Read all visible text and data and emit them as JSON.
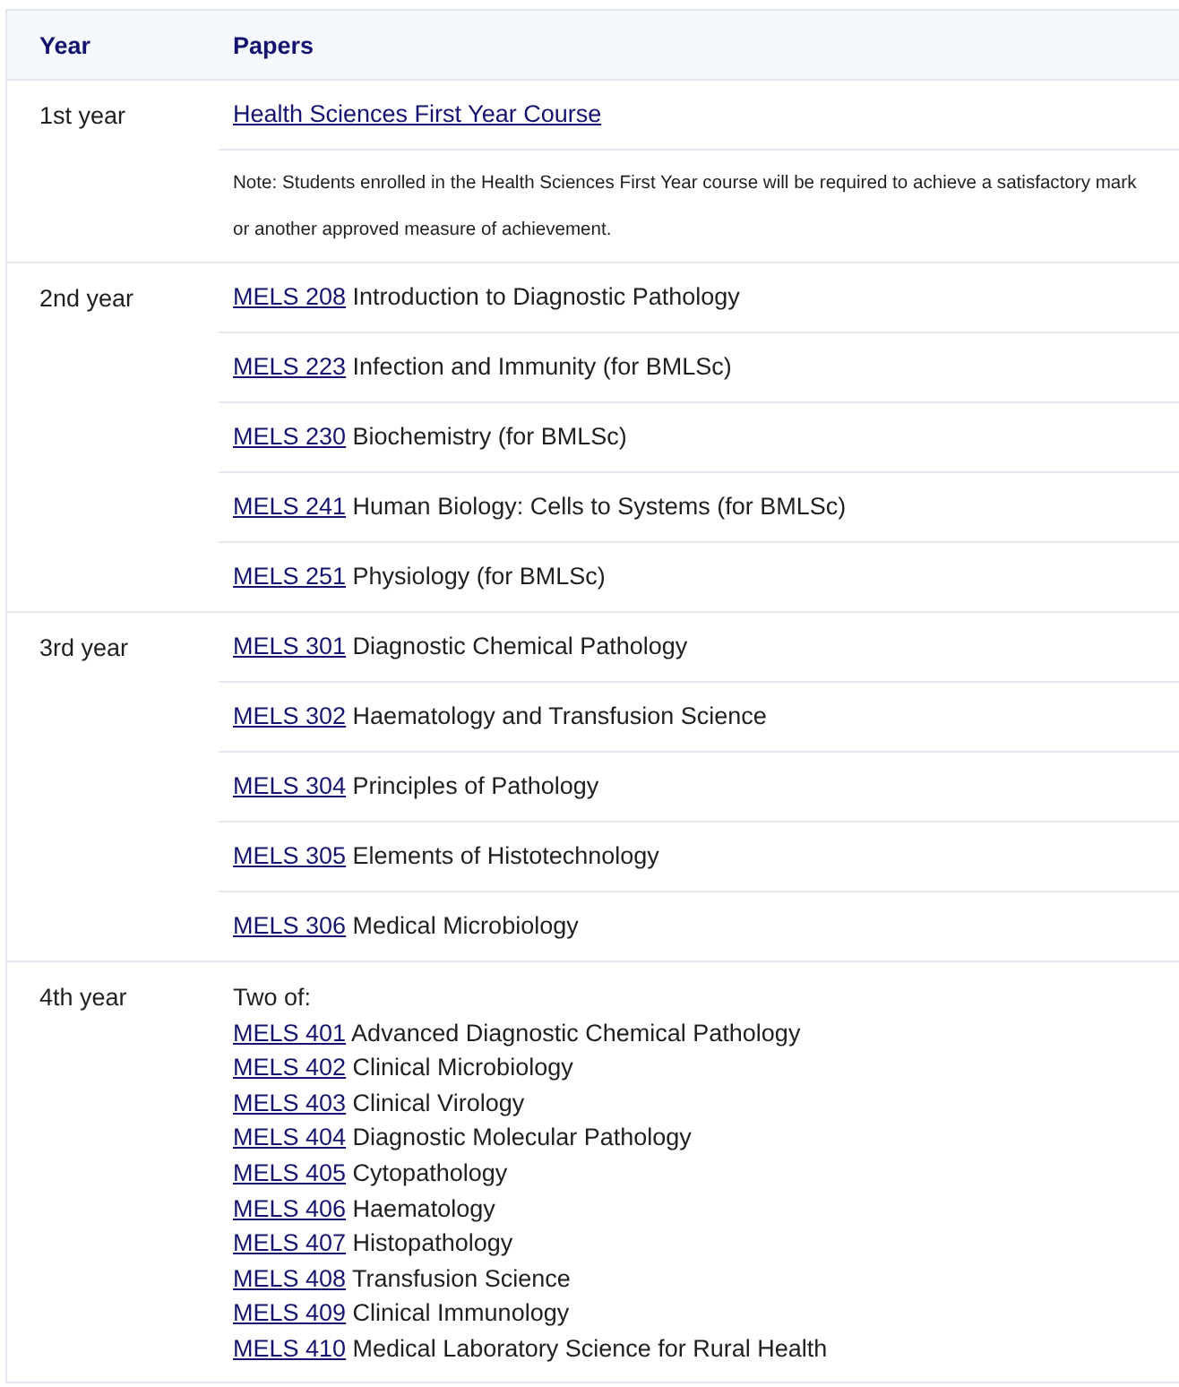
{
  "table": {
    "columns": [
      "Year",
      "Papers"
    ],
    "rows": [
      {
        "year": "1st year",
        "papers": [
          {
            "kind": "link",
            "text": "Health Sciences First Year Course"
          },
          {
            "kind": "note",
            "lines": [
              "Note: Students enrolled in the Health Sciences First Year course will be required to achieve a satisfactory mark",
              "or another approved measure of achievement."
            ]
          }
        ]
      },
      {
        "year": "2nd year",
        "papers": [
          {
            "kind": "paper",
            "code": "MELS 208",
            "title": "Introduction to Diagnostic Pathology"
          },
          {
            "kind": "paper",
            "code": "MELS 223",
            "title": "Infection and Immunity (for BMLSc)"
          },
          {
            "kind": "paper",
            "code": "MELS 230",
            "title": "Biochemistry (for BMLSc)"
          },
          {
            "kind": "paper",
            "code": "MELS 241",
            "title": "Human Biology: Cells to Systems (for BMLSc)"
          },
          {
            "kind": "paper",
            "code": "MELS 251",
            "title": "Physiology (for BMLSc)"
          }
        ]
      },
      {
        "year": "3rd year",
        "papers": [
          {
            "kind": "paper",
            "code": "MELS 301",
            "title": "Diagnostic Chemical Pathology"
          },
          {
            "kind": "paper",
            "code": "MELS 302",
            "title": "Haematology and Transfusion Science"
          },
          {
            "kind": "paper",
            "code": "MELS 304",
            "title": "Principles of Pathology"
          },
          {
            "kind": "paper",
            "code": "MELS 305",
            "title": "Elements of Histotechnology"
          },
          {
            "kind": "paper",
            "code": "MELS 306",
            "title": "Medical Microbiology"
          }
        ]
      },
      {
        "year": "4th year",
        "papers": [
          {
            "kind": "choice",
            "intro": "Two of:",
            "options": [
              {
                "code": "MELS 401",
                "title": "Advanced Diagnostic Chemical Pathology"
              },
              {
                "code": "MELS 402",
                "title": "Clinical Microbiology"
              },
              {
                "code": "MELS 403",
                "title": "Clinical Virology"
              },
              {
                "code": "MELS 404",
                "title": "Diagnostic Molecular Pathology"
              },
              {
                "code": "MELS 405",
                "title": "Cytopathology"
              },
              {
                "code": "MELS 406",
                "title": "Haematology"
              },
              {
                "code": "MELS 407",
                "title": "Histopathology"
              },
              {
                "code": "MELS 408",
                "title": "Transfusion Science"
              },
              {
                "code": "MELS 409",
                "title": "Clinical Immunology"
              },
              {
                "code": "MELS 410",
                "title": "Medical Laboratory Science for Rural Health"
              }
            ]
          }
        ]
      }
    ]
  }
}
